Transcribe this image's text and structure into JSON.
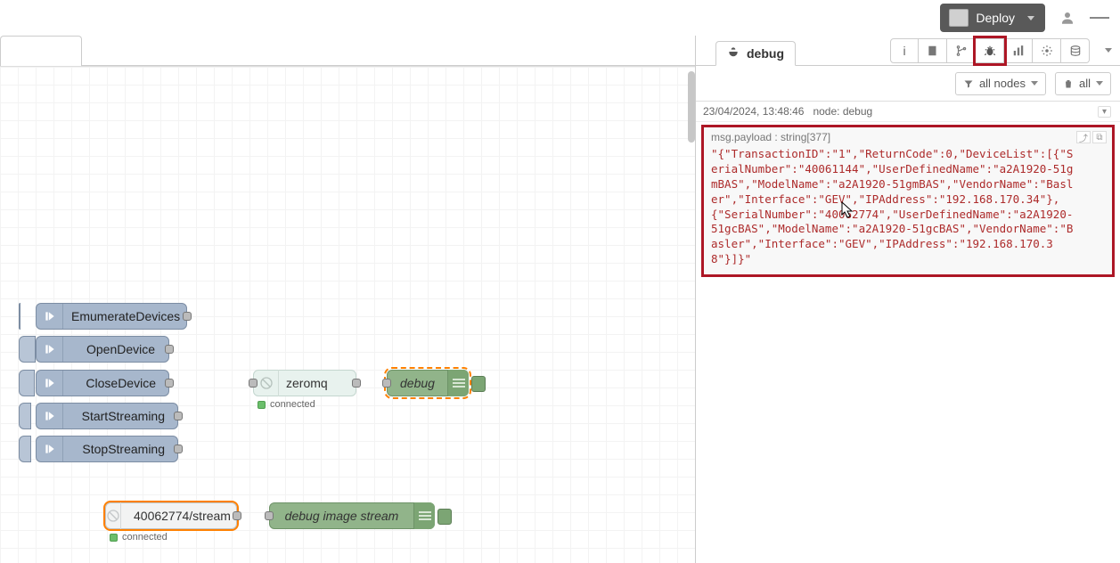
{
  "header": {
    "deploy_label": "Deploy"
  },
  "sidebar": {
    "tab_label": "debug",
    "filter_label": "all nodes",
    "trash_label": "all"
  },
  "debug": {
    "timestamp": "23/04/2024, 13:48:46",
    "source_prefix": "node: ",
    "source": "debug",
    "meta": "msg.payload : string[377]",
    "body": "\"{\"TransactionID\":\"1\",\"ReturnCode\":0,\"DeviceList\":[{\"SerialNumber\":\"40061144\",\"UserDefinedName\":\"a2A1920-51gmBAS\",\"ModelName\":\"a2A1920-51gmBAS\",\"VendorName\":\"Basler\",\"Interface\":\"GEV\",\"IPAddress\":\"192.168.170.34\"},{\"SerialNumber\":\"40062774\",\"UserDefinedName\":\"a2A1920-51gcBAS\",\"ModelName\":\"a2A1920-51gcBAS\",\"VendorName\":\"Basler\",\"Interface\":\"GEV\",\"IPAddress\":\"192.168.170.38\"}]}\""
  },
  "flow": {
    "inject_nodes": [
      "EmumerateDevices",
      "OpenDevice",
      "CloseDevice",
      "StartStreaming",
      "StopStreaming"
    ],
    "zeromq_label": "zeromq",
    "zeromq_status": "connected",
    "debug_label": "debug",
    "stream_label": "40062774/stream",
    "stream_status": "connected",
    "debug_image_label": "debug image stream"
  }
}
